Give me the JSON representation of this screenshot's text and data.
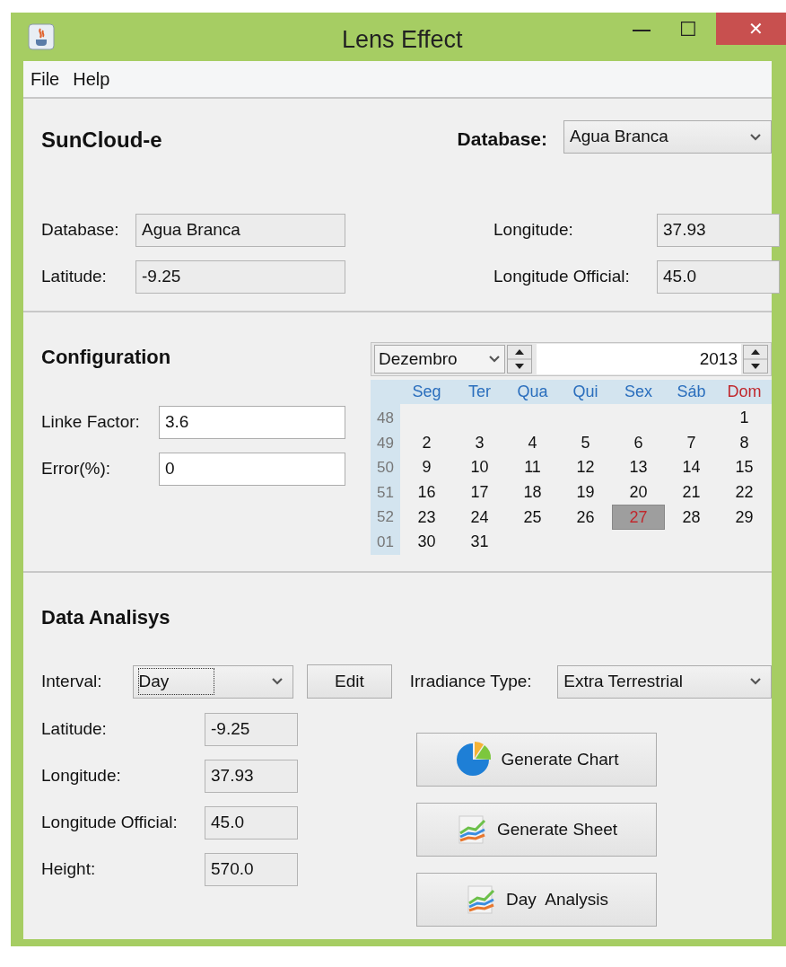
{
  "window": {
    "title": "Lens Effect",
    "controls": [
      "—",
      "☐",
      "✕"
    ]
  },
  "menu": [
    "File",
    "Help"
  ],
  "location": {
    "title": "SunCloud-e",
    "database_label": "Database:",
    "database_select": "Agua Branca",
    "fields": [
      {
        "label": "Database:",
        "value": "Agua Branca"
      },
      {
        "label": "Latitude:",
        "value": "-9.25"
      }
    ],
    "right_fields": [
      {
        "label": "Longitude:",
        "value": "37.93"
      },
      {
        "label": "Longitude Official:",
        "value": "45.0"
      }
    ]
  },
  "configuration": {
    "title": "Configuration",
    "fields": [
      {
        "label": "Linke Factor:",
        "value": "3.6"
      },
      {
        "label": "Error(%):",
        "value": "0"
      }
    ],
    "calendar": {
      "month": "Dezembro",
      "year": "2013",
      "weekdays": [
        {
          "label": "Seg",
          "color": "#2a6ebd"
        },
        {
          "label": "Ter",
          "color": "#2a6ebd"
        },
        {
          "label": "Qua",
          "color": "#2a6ebd"
        },
        {
          "label": "Qui",
          "color": "#2a6ebd"
        },
        {
          "label": "Sex",
          "color": "#2a6ebd"
        },
        {
          "label": "Sáb",
          "color": "#2a6ebd"
        },
        {
          "label": "Dom",
          "color": "#c0282d"
        }
      ],
      "weeks": [
        {
          "week": "48",
          "starts_late": true,
          "days": [
            {
              "label": "1",
              "selected": false
            }
          ]
        },
        {
          "week": "49",
          "days": [
            {
              "label": "2",
              "selected": false
            },
            {
              "label": "3",
              "selected": false
            },
            {
              "label": "4",
              "selected": false
            },
            {
              "label": "5",
              "selected": false
            },
            {
              "label": "6",
              "selected": false
            },
            {
              "label": "7",
              "selected": false
            },
            {
              "label": "8",
              "selected": false
            }
          ]
        },
        {
          "week": "50",
          "days": [
            {
              "label": "9",
              "selected": false
            },
            {
              "label": "10",
              "selected": false
            },
            {
              "label": "11",
              "selected": false
            },
            {
              "label": "12",
              "selected": false
            },
            {
              "label": "13",
              "selected": false
            },
            {
              "label": "14",
              "selected": false
            },
            {
              "label": "15",
              "selected": false
            }
          ]
        },
        {
          "week": "51",
          "days": [
            {
              "label": "16",
              "selected": false
            },
            {
              "label": "17",
              "selected": false
            },
            {
              "label": "18",
              "selected": false
            },
            {
              "label": "19",
              "selected": false
            },
            {
              "label": "20",
              "selected": false
            },
            {
              "label": "21",
              "selected": false
            },
            {
              "label": "22",
              "selected": false
            }
          ]
        },
        {
          "week": "52",
          "days": [
            {
              "label": "23",
              "selected": false
            },
            {
              "label": "24",
              "selected": false
            },
            {
              "label": "25",
              "selected": false
            },
            {
              "label": "26",
              "selected": false
            },
            {
              "label": "27",
              "selected": true
            },
            {
              "label": "28",
              "selected": false
            },
            {
              "label": "29",
              "selected": false
            }
          ]
        },
        {
          "week": "01",
          "starts_late": false,
          "days": [
            {
              "label": "30",
              "selected": false
            },
            {
              "label": "31",
              "selected": false
            }
          ]
        }
      ]
    }
  },
  "analysis": {
    "title": "Data Analisys",
    "interval_label": "Interval:",
    "interval": "Day",
    "edit_button": "Edit",
    "irradiance_label": "Irradiance Type:",
    "irradiance": "Extra Terrestrial",
    "fields": [
      {
        "label": "Latitude:",
        "value": "-9.25"
      },
      {
        "label": "Longitude:",
        "value": "37.93"
      },
      {
        "label": "Longitude Official:",
        "value": "45.0"
      },
      {
        "label": "Height:",
        "value": "570.0"
      }
    ],
    "buttons": [
      {
        "label": "Generate Chart",
        "kind": "chart"
      },
      {
        "label": "Generate Sheet",
        "kind": "sheet"
      },
      {
        "label": "Day  Analysis",
        "kind": "sheet"
      }
    ]
  }
}
